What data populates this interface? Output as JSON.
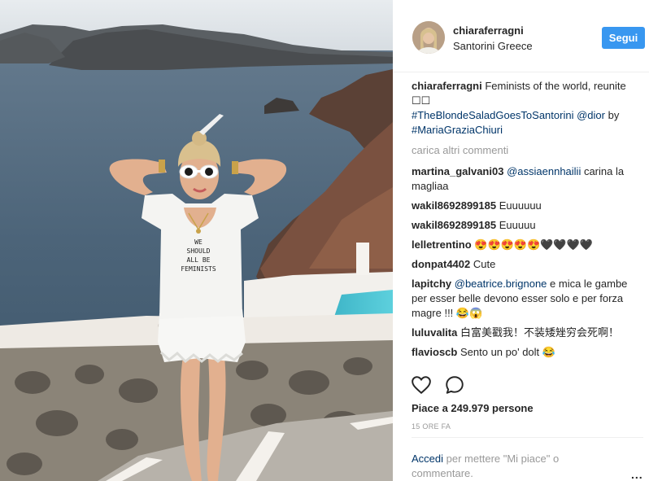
{
  "post": {
    "username": "chiaraferragni",
    "location": "Santorini Greece",
    "follow_label": "Segui"
  },
  "caption": {
    "username": "chiaraferragni",
    "text": "Feminists of the world, reunite ☐☐",
    "hashtag": "#TheBlondeSaladGoesToSantorini",
    "mention1": "@dior",
    "by": "by",
    "mention2": "#MariaGraziaChiuri"
  },
  "photo_text": "WE SHOULD ALL BE FEMINISTS",
  "load_more": "carica altri commenti",
  "comments": [
    {
      "user": "martina_galvani03",
      "mention": "@assiaennhailii",
      "text": "carina la magliaa"
    },
    {
      "user": "wakil8692899185",
      "mention": "",
      "text": "Euuuuuu"
    },
    {
      "user": "wakil8692899185",
      "mention": "",
      "text": "Euuuuu"
    },
    {
      "user": "lelletrentino",
      "mention": "",
      "text": "😍😍😍😍😍🖤🖤🖤🖤"
    },
    {
      "user": "donpat4402",
      "mention": "",
      "text": "Cute"
    },
    {
      "user": "lapitchy",
      "mention": "@beatrice.brignone",
      "text": "e mica le gambe per esser belle devono esser solo e per forza magre !!! 😂😱"
    },
    {
      "user": "luluvalita",
      "mention": "",
      "text": "白富美戳我！不装矮矬穷会死啊！"
    },
    {
      "user": "flavioscb",
      "mention": "",
      "text": "Sento un po' dolt 😂"
    }
  ],
  "likes_text": "Piace a 249.979 persone",
  "time_text": "15 ORE FA",
  "add_comment": {
    "link": "Accedi",
    "text": "per mettere \"Mi piace\" o commentare."
  },
  "more_label": "..."
}
